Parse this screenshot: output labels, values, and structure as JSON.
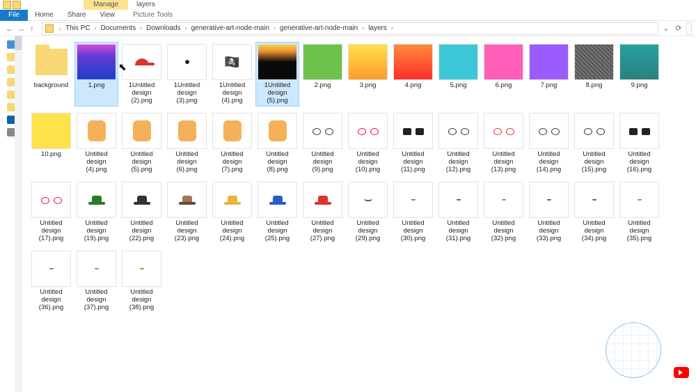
{
  "titlebar": {
    "context_tab": "Manage",
    "window_title": "layers"
  },
  "ribbon": {
    "file": "File",
    "tabs": [
      "Home",
      "Share",
      "View"
    ],
    "context_tab": "Picture Tools"
  },
  "nav": {
    "crumbs": [
      "This PC",
      "Documents",
      "Downloads",
      "generative-art-node-main",
      "generative-art-node-main",
      "layers"
    ]
  },
  "files": [
    {
      "name": "background",
      "kind": "folder"
    },
    {
      "name": "1.png",
      "kind": "grad",
      "cls": "g1",
      "selected": true
    },
    {
      "name": "1Untitled design (2).png",
      "kind": "cap"
    },
    {
      "name": "1Untitled design (3).png",
      "kind": "eye"
    },
    {
      "name": "1Untitled design (4).png",
      "kind": "pirate"
    },
    {
      "name": "1Untitled design (5).png",
      "kind": "grad",
      "cls": "g2",
      "selected": true
    },
    {
      "name": "2.png",
      "kind": "grad",
      "cls": "g3"
    },
    {
      "name": "3.png",
      "kind": "grad",
      "cls": "g4"
    },
    {
      "name": "4.png",
      "kind": "grad",
      "cls": "g5"
    },
    {
      "name": "5.png",
      "kind": "grad",
      "cls": "g6"
    },
    {
      "name": "6.png",
      "kind": "grad",
      "cls": "g7"
    },
    {
      "name": "7.png",
      "kind": "grad",
      "cls": "g8"
    },
    {
      "name": "8.png",
      "kind": "grad",
      "cls": "g9"
    },
    {
      "name": "9.png",
      "kind": "grad",
      "cls": "g10"
    },
    {
      "name": "10.png",
      "kind": "grad",
      "cls": "g11"
    },
    {
      "name": "Untitled design (4).png",
      "kind": "cat"
    },
    {
      "name": "Untitled design (5).png",
      "kind": "cat"
    },
    {
      "name": "Untitled design (6).png",
      "kind": "cat"
    },
    {
      "name": "Untitled design (7).png",
      "kind": "cat"
    },
    {
      "name": "Untitled design (8).png",
      "kind": "cat"
    },
    {
      "name": "Untitled design (9).png",
      "kind": "glasses"
    },
    {
      "name": "Untitled design (10).png",
      "kind": "glasses",
      "cls": "pink"
    },
    {
      "name": "Untitled design (11).png",
      "kind": "glasses",
      "cls": "dark"
    },
    {
      "name": "Untitled design (12).png",
      "kind": "glasses"
    },
    {
      "name": "Untitled design (13).png",
      "kind": "glasses",
      "cls": "red"
    },
    {
      "name": "Untitled design (14).png",
      "kind": "glasses"
    },
    {
      "name": "Untitled design (15).png",
      "kind": "glasses"
    },
    {
      "name": "Untitled design (16).png",
      "kind": "glasses",
      "cls": "dark"
    },
    {
      "name": "Untitled design (17).png",
      "kind": "glasses",
      "cls": "pink"
    },
    {
      "name": "Untitled design (19).png",
      "kind": "hat",
      "cls": "green"
    },
    {
      "name": "Untitled design (22).png",
      "kind": "hat"
    },
    {
      "name": "Untitled design (23).png",
      "kind": "hat",
      "cls": "viking"
    },
    {
      "name": "Untitled design (24).png",
      "kind": "hat",
      "cls": "yellow"
    },
    {
      "name": "Untitled design (25).png",
      "kind": "hat",
      "cls": "blue"
    },
    {
      "name": "Untitled design (27).png",
      "kind": "hat",
      "cls": "red"
    },
    {
      "name": "Untitled design (29).png",
      "kind": "mouth",
      "cls": "r"
    },
    {
      "name": "Untitled design (30).png",
      "kind": "mouth",
      "cls": "p tiny"
    },
    {
      "name": "Untitled design (31).png",
      "kind": "mouth",
      "cls": "r tiny"
    },
    {
      "name": "Untitled design (32).png",
      "kind": "mouth",
      "cls": "tiny"
    },
    {
      "name": "Untitled design (33).png",
      "kind": "mouth",
      "cls": "r tiny"
    },
    {
      "name": "Untitled design (34).png",
      "kind": "mouth",
      "cls": "r tiny"
    },
    {
      "name": "Untitled design (35).png",
      "kind": "mouth",
      "cls": "tiny"
    },
    {
      "name": "Untitled design (36).png",
      "kind": "mouth",
      "cls": "p tiny"
    },
    {
      "name": "Untitled design (37).png",
      "kind": "mouth",
      "cls": "tiny"
    },
    {
      "name": "Untitled design (38).png",
      "kind": "mouth",
      "cls": "tiny"
    }
  ]
}
